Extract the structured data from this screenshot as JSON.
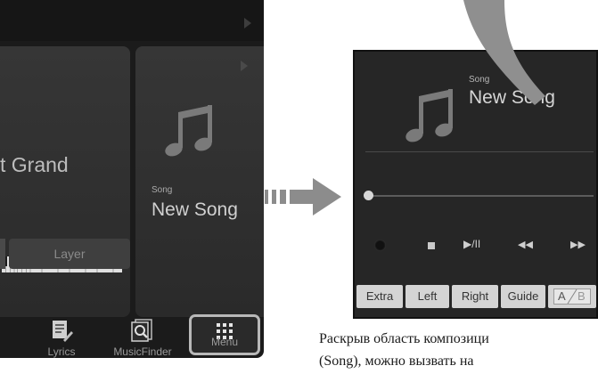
{
  "left_panel": {
    "voice_name": "t Grand",
    "layer_label": "Layer",
    "song_card": {
      "label": "Song",
      "name": "New Song"
    },
    "bottom_buttons": [
      {
        "label": "Lyrics",
        "icon": "lyrics-icon"
      },
      {
        "label": "MusicFinder",
        "icon": "musicfinder-icon"
      },
      {
        "label": "Menu",
        "icon": "grid-menu-icon"
      }
    ]
  },
  "song_panel": {
    "label": "Song",
    "name": "New Song",
    "controls": {
      "record": "record-icon",
      "stop": "stop-icon",
      "play_pause": "▶/II",
      "rewind": "◀◀",
      "fast_forward": "▶▶"
    },
    "buttons": [
      "Extra",
      "Left",
      "Right",
      "Guide"
    ],
    "ab_button": {
      "a": "A",
      "b": "B"
    },
    "progress": 0
  },
  "caption": {
    "line1": "Раскрыв область композици",
    "line2": "(Song), можно вызвать на"
  },
  "colors": {
    "screen_bg": "#1b1b1b",
    "card_bg": "#333333",
    "button_bg": "#d4d4d4",
    "menu_highlight": "#b8b8b8",
    "arrow": "#8c8c8c"
  }
}
